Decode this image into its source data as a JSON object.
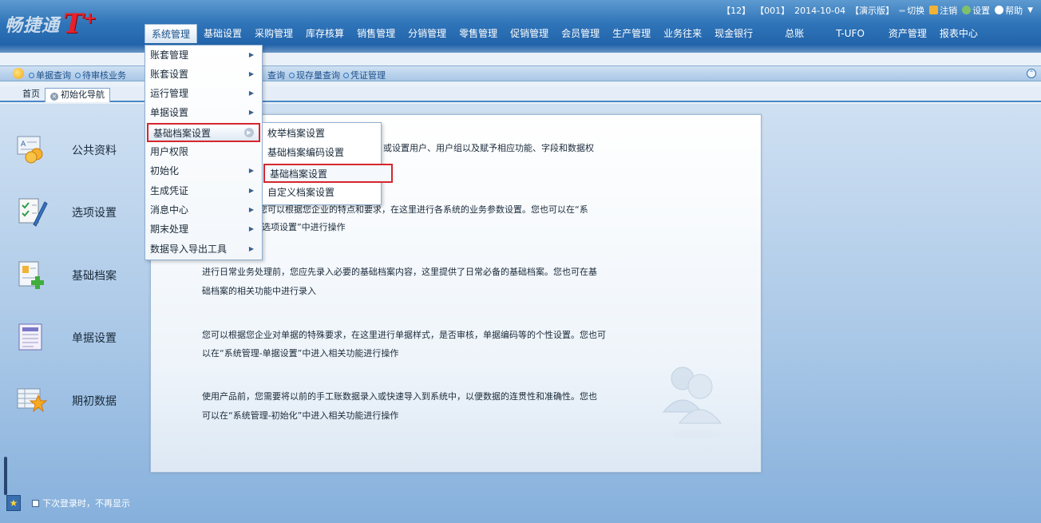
{
  "header": {
    "brand": "畅捷通",
    "product": "T",
    "product_suffix": "+",
    "status": {
      "count": "【12】",
      "account": "【001】",
      "date": "2014-10-04",
      "edition": "【演示版】",
      "switch": "切换",
      "logout": "注销",
      "settings": "设置",
      "help": "帮助"
    }
  },
  "menubar": [
    {
      "label": "系统管理",
      "active": true
    },
    {
      "label": "基础设置"
    },
    {
      "label": "采购管理"
    },
    {
      "label": "库存核算"
    },
    {
      "label": "销售管理"
    },
    {
      "label": "分销管理"
    },
    {
      "label": "零售管理"
    },
    {
      "label": "促销管理"
    },
    {
      "label": "会员管理"
    },
    {
      "label": "生产管理"
    },
    {
      "label": "业务往来"
    },
    {
      "label": "现金银行"
    },
    {
      "label": "总账"
    },
    {
      "label": "T-UFO"
    },
    {
      "label": "资产管理"
    },
    {
      "label": "报表中心"
    }
  ],
  "quickbar": {
    "links": [
      "单据查询",
      "待审核业务",
      "查询",
      "现存量查询",
      "凭证管理"
    ]
  },
  "tabs": {
    "home": "首页",
    "active": "初始化导航"
  },
  "dropdown": [
    {
      "label": "账套管理"
    },
    {
      "label": "账套设置"
    },
    {
      "label": "运行管理"
    },
    {
      "label": "单据设置"
    },
    {
      "label": "基础档案设置",
      "highlight": true
    },
    {
      "label": "用户权限"
    },
    {
      "label": "初始化"
    },
    {
      "label": "生成凭证"
    },
    {
      "label": "消息中心"
    },
    {
      "label": "期末处理"
    },
    {
      "label": "数据导入导出工具"
    }
  ],
  "submenu": [
    {
      "label": "枚举档案设置"
    },
    {
      "label": "基础档案编码设置"
    },
    {
      "label": "基础档案设置",
      "highlight": true
    },
    {
      "label": "自定义档案设置"
    }
  ],
  "left_nav": [
    {
      "label": "公共资料"
    },
    {
      "label": "选项设置"
    },
    {
      "label": "基础档案"
    },
    {
      "label": "单据设置"
    },
    {
      "label": "期初数据"
    }
  ],
  "panel": {
    "p1_line1": "，或设置用户、用户组以及赋予相应功能、字段和数据权",
    "p2_line1": "，您可以根据您企业的特点和要求，在这里进行各系统的业务参数设置。您也可以在“系",
    "p2_line2": "置-选项设置”中进行操作",
    "p3_line1": "进行日常业务处理前，您应先录入必要的基础档案内容，这里提供了日常必备的基础档案。您也可在基",
    "p3_line2": "础档案的相关功能中进行录入",
    "p4_line1": "您可以根据您企业对单据的特殊要求，在这里进行单据样式，是否审核，单据编码等的个性设置。您也可",
    "p4_line2": "以在“系统管理-单据设置”中进入相关功能进行操作",
    "p5_line1": "使用产品前，您需要将以前的手工账数据录入或快速导入到系统中，以便数据的连贯性和准确性。您也",
    "p5_line2": "可以在“系统管理-初始化”中进入相关功能进行操作"
  },
  "bottom": {
    "no_show": "下次登录时，不再显示"
  },
  "colors": {
    "header_blue": "#2f74b8",
    "highlight_red": "#d6262e",
    "logo_red": "#e8202a"
  }
}
